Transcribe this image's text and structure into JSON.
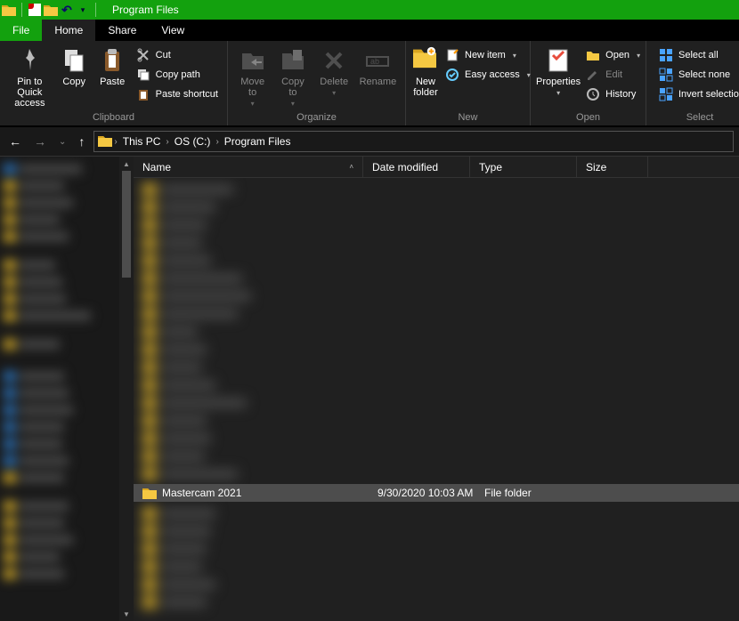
{
  "window": {
    "title": "Program Files"
  },
  "tabs": {
    "file": "File",
    "home": "Home",
    "share": "Share",
    "view": "View"
  },
  "ribbon": {
    "clipboard": {
      "label": "Clipboard",
      "pin": "Pin to Quick\naccess",
      "copy": "Copy",
      "paste": "Paste",
      "cut": "Cut",
      "copy_path": "Copy path",
      "paste_shortcut": "Paste shortcut"
    },
    "organize": {
      "label": "Organize",
      "move_to": "Move\nto",
      "copy_to": "Copy\nto",
      "delete": "Delete",
      "rename": "Rename"
    },
    "new_g": {
      "label": "New",
      "new_folder": "New\nfolder",
      "new_item": "New item",
      "easy_access": "Easy access"
    },
    "open_g": {
      "label": "Open",
      "properties": "Properties",
      "open": "Open",
      "edit": "Edit",
      "history": "History"
    },
    "select_g": {
      "label": "Select",
      "select_all": "Select all",
      "select_none": "Select none",
      "invert": "Invert selection"
    }
  },
  "breadcrumb": {
    "this_pc": "This PC",
    "drive": "OS (C:)",
    "folder": "Program Files"
  },
  "columns": {
    "name": "Name",
    "date": "Date modified",
    "type": "Type",
    "size": "Size"
  },
  "selected_row": {
    "name": "Mastercam 2021",
    "date": "9/30/2020 10:03 AM",
    "type": "File folder"
  }
}
